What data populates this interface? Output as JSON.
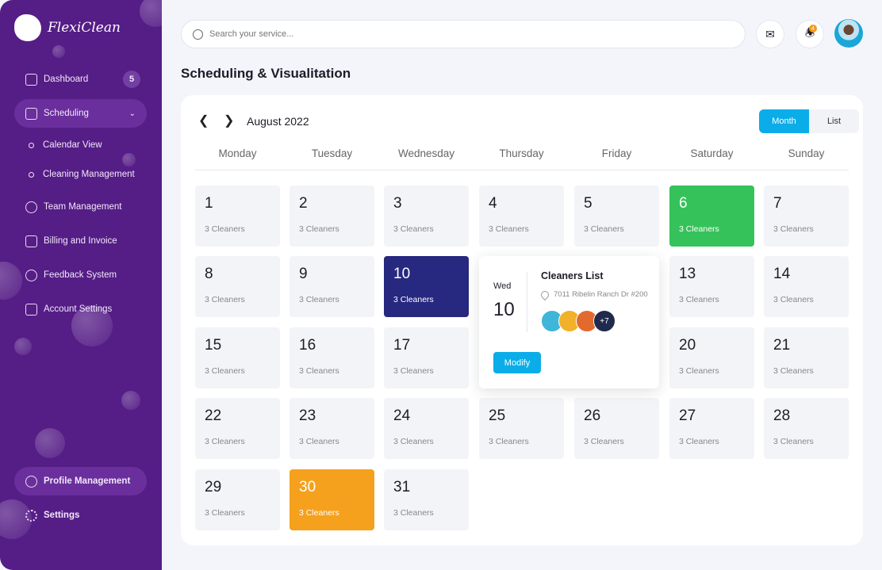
{
  "brand": {
    "name": "FlexiClean"
  },
  "sidebar": {
    "items": [
      {
        "label": "Dashboard",
        "badge": "5"
      },
      {
        "label": "Scheduling"
      },
      {
        "label": "Team Management"
      },
      {
        "label": "Billing and Invoice"
      },
      {
        "label": "Feedback System"
      },
      {
        "label": "Account Settings"
      }
    ],
    "subitems": [
      {
        "label": "Calendar View"
      },
      {
        "label": "Cleaning Management"
      }
    ],
    "bottom": [
      {
        "label": "Profile Management"
      },
      {
        "label": "Settings"
      }
    ]
  },
  "header": {
    "search_placeholder": "Search your service...",
    "notifications": "4"
  },
  "page": {
    "title": "Scheduling & Visualitation"
  },
  "calendar": {
    "month": "August 2022",
    "views": [
      "Month",
      "List"
    ],
    "active_view": "Month",
    "weekdays": [
      "Monday",
      "Tuesday",
      "Wednesday",
      "Thursday",
      "Friday",
      "Saturday",
      "Sunday"
    ],
    "days": [
      {
        "d": "1",
        "c": "3 Cleaners"
      },
      {
        "d": "2",
        "c": "3 Cleaners"
      },
      {
        "d": "3",
        "c": "3 Cleaners"
      },
      {
        "d": "4",
        "c": "3 Cleaners"
      },
      {
        "d": "5",
        "c": "3 Cleaners"
      },
      {
        "d": "6",
        "c": "3 Cleaners",
        "state": "green"
      },
      {
        "d": "7",
        "c": "3 Cleaners"
      },
      {
        "d": "8",
        "c": "3 Cleaners"
      },
      {
        "d": "9",
        "c": "3 Cleaners"
      },
      {
        "d": "10",
        "c": "3 Cleaners",
        "state": "sel"
      },
      null,
      null,
      {
        "d": "13",
        "c": "3 Cleaners"
      },
      {
        "d": "14",
        "c": "3 Cleaners"
      },
      {
        "d": "15",
        "c": "3 Cleaners"
      },
      {
        "d": "16",
        "c": "3 Cleaners"
      },
      {
        "d": "17",
        "c": "3 Cleaners"
      },
      null,
      null,
      {
        "d": "20",
        "c": "3 Cleaners"
      },
      {
        "d": "21",
        "c": "3 Cleaners"
      },
      {
        "d": "22",
        "c": "3 Cleaners"
      },
      {
        "d": "23",
        "c": "3 Cleaners"
      },
      {
        "d": "24",
        "c": "3 Cleaners"
      },
      {
        "d": "25",
        "c": "3 Cleaners"
      },
      {
        "d": "26",
        "c": "3 Cleaners"
      },
      {
        "d": "27",
        "c": "3 Cleaners"
      },
      {
        "d": "28",
        "c": "3 Cleaners"
      },
      {
        "d": "29",
        "c": "3 Cleaners"
      },
      {
        "d": "30",
        "c": "3 Cleaners",
        "state": "orange"
      },
      {
        "d": "31",
        "c": "3 Cleaners"
      }
    ]
  },
  "popup": {
    "weekday": "Wed",
    "day": "10",
    "title": "Cleaners List",
    "address": "7011 Ribelin Ranch Dr #200",
    "more": "+7",
    "button": "Modify",
    "avatar_colors": [
      "#3fb6d9",
      "#f2b12a",
      "#7fa9b8"
    ]
  },
  "colors": {
    "sidebar": "#551d86",
    "accent": "#0bade8",
    "selected": "#27287f",
    "green": "#36c25a",
    "orange": "#f5a11d"
  }
}
